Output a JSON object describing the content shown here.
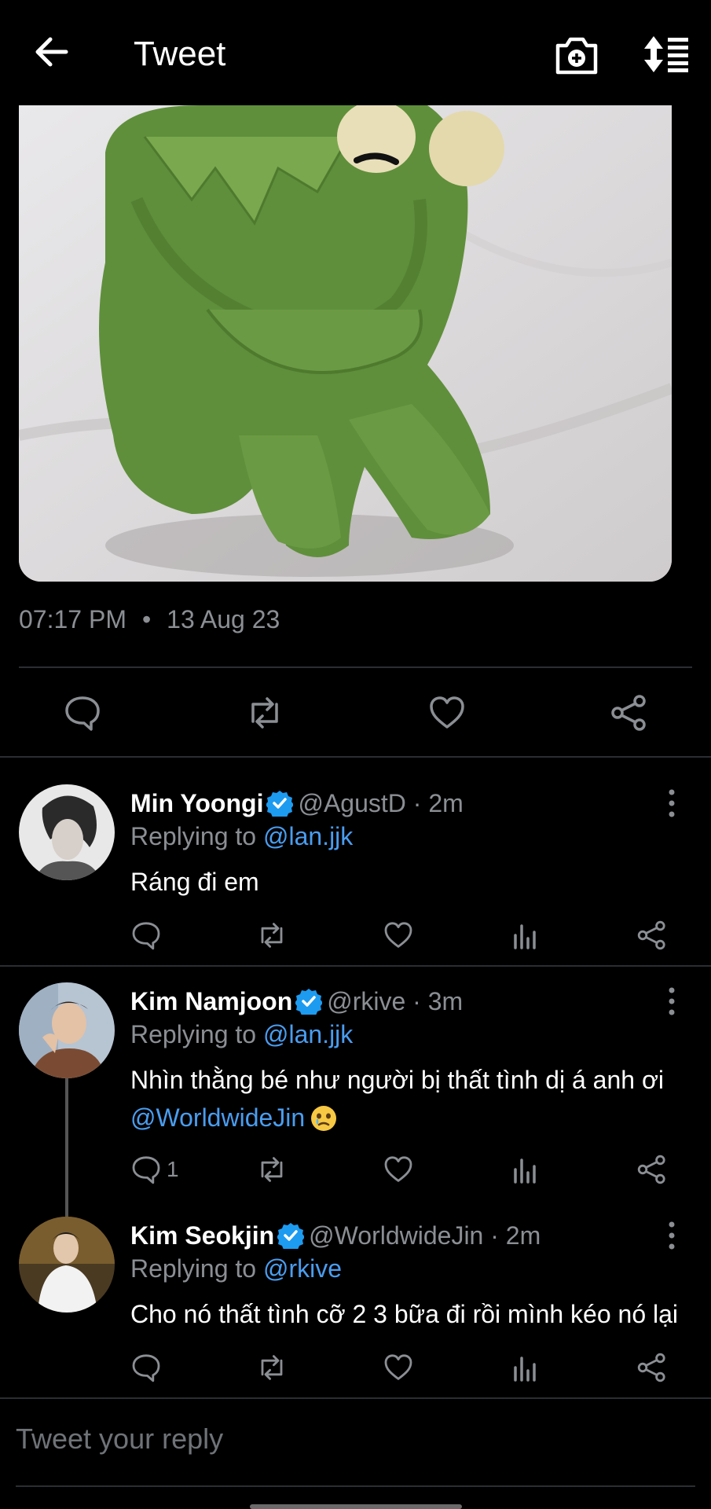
{
  "header": {
    "title": "Tweet",
    "icons": [
      "back-arrow-icon",
      "camera-add-icon",
      "sort-icon"
    ]
  },
  "tweet": {
    "time": "07:17 PM",
    "separator": "•",
    "date": "13 Aug 23",
    "actions": [
      "reply-icon",
      "retweet-icon",
      "like-icon",
      "share-icon"
    ]
  },
  "replies": [
    {
      "name": "Min Yoongi",
      "handle": "@AgustD",
      "time": "· 2m",
      "replying_label": "Replying to",
      "replying_to": "@lan.jjk",
      "text": "Ráng đi em",
      "reply_count": ""
    },
    {
      "name": "Kim Namjoon",
      "handle": "@rkive",
      "time": "· 3m",
      "replying_label": "Replying to",
      "replying_to": "@lan.jjk",
      "text": "Nhìn thằng bé như người bị thất tình dị á anh ơi",
      "text_mention": "@WorldwideJin",
      "reply_count": "1"
    },
    {
      "name": "Kim Seokjin",
      "handle": "@WorldwideJin",
      "time": "· 2m",
      "replying_label": "Replying to",
      "replying_to": "@rkive",
      "text": "Cho nó thất tình cỡ 2 3 bữa đi rồi mình kéo nó lại",
      "reply_count": ""
    }
  ],
  "composer": {
    "placeholder": "Tweet your reply"
  },
  "colors": {
    "background": "#000000",
    "secondary_text": "#8b8f94",
    "link": "#4a9df0",
    "verified": "#1d9bf0"
  }
}
